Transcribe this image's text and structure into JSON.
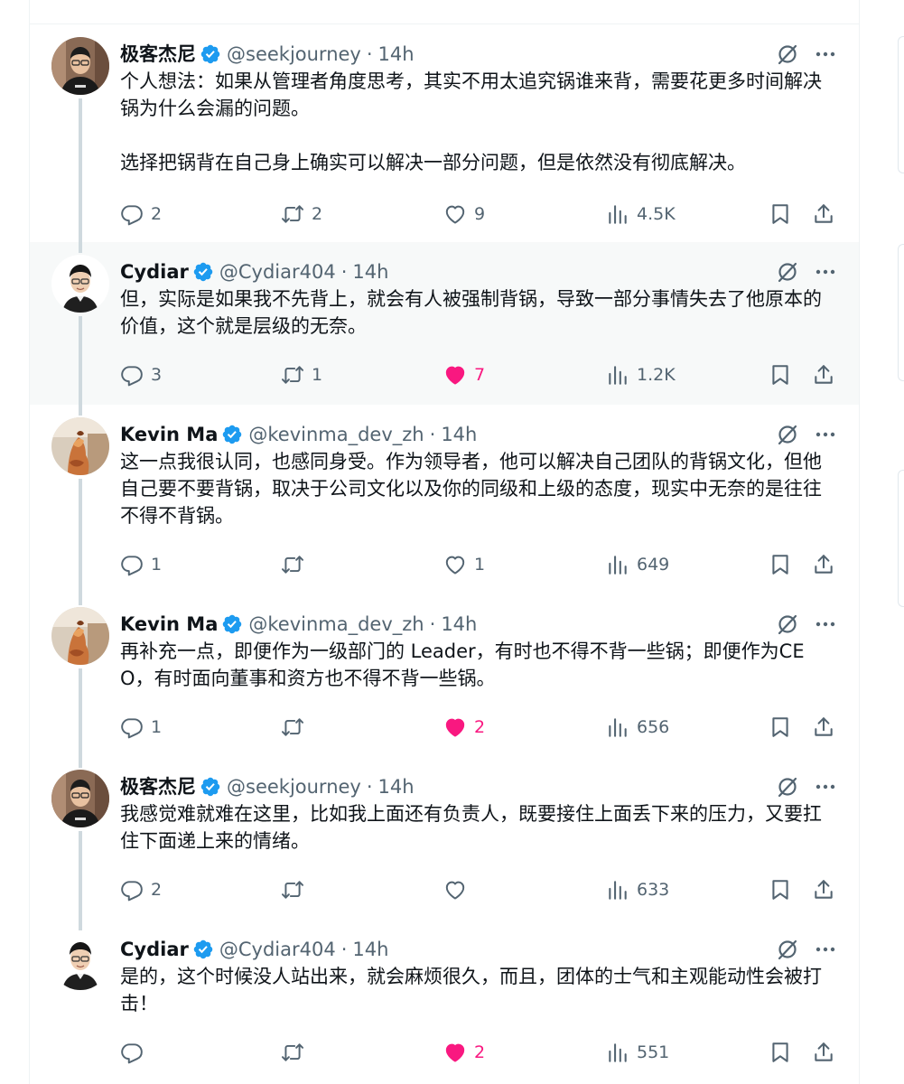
{
  "tweets": [
    {
      "name": "极客杰尼",
      "handle": "@seekjourney",
      "time": "14h",
      "text": "个人想法：如果从管理者角度思考，其实不用太追究锅谁来背，需要花更多时间解决锅为什么会漏的问题。\n\n选择把锅背在自己身上确实可以解决一部分问题，但是依然没有彻底解决。",
      "replies": "2",
      "retweets": "2",
      "likes": "9",
      "views": "4.5K",
      "liked": false,
      "avatar": "avatar-seek"
    },
    {
      "name": "Cydiar",
      "handle": "@Cydiar404",
      "time": "14h",
      "text": "但，实际是如果我不先背上，就会有人被强制背锅，导致一部分事情失去了他原本的价值，这个就是层级的无奈。",
      "replies": "3",
      "retweets": "1",
      "likes": "7",
      "views": "1.2K",
      "liked": true,
      "avatar": "avatar-cydiar"
    },
    {
      "name": "Kevin Ma",
      "handle": "@kevinma_dev_zh",
      "time": "14h",
      "text": "这一点我很认同，也感同身受。作为领导者，他可以解决自己团队的背锅文化，但他自己要不要背锅，取决于公司文化以及你的同级和上级的态度，现实中无奈的是往往不得不背锅。",
      "replies": "1",
      "retweets": "",
      "likes": "1",
      "views": "649",
      "liked": false,
      "avatar": "avatar-kevin"
    },
    {
      "name": "Kevin Ma",
      "handle": "@kevinma_dev_zh",
      "time": "14h",
      "text": "再补充一点，即便作为一级部门的 Leader，有时也不得不背一些锅；即便作为CEO，有时面向董事和资方也不得不背一些锅。",
      "replies": "1",
      "retweets": "",
      "likes": "2",
      "views": "656",
      "liked": true,
      "avatar": "avatar-kevin"
    },
    {
      "name": "极客杰尼",
      "handle": "@seekjourney",
      "time": "14h",
      "text": "我感觉难就难在这里，比如我上面还有负责人，既要接住上面丢下来的压力，又要扛住下面递上来的情绪。",
      "replies": "2",
      "retweets": "",
      "likes": "",
      "views": "633",
      "liked": false,
      "avatar": "avatar-seek"
    },
    {
      "name": "Cydiar",
      "handle": "@Cydiar404",
      "time": "14h",
      "text": "是的，这个时候没人站出来，就会麻烦很久，而且，团体的士气和主观能动性会被打击！",
      "replies": "",
      "retweets": "",
      "likes": "2",
      "views": "551",
      "liked": true,
      "avatar": "avatar-cydiar"
    }
  ],
  "colors": {
    "text": "#0f1419",
    "muted": "#536471",
    "verified": "#1d9bf0",
    "like": "#f91880",
    "thread": "#cfd9de",
    "highlight": "#f7f9f9"
  },
  "icons": [
    "verified-badge-icon",
    "grok-icon",
    "more-icon",
    "reply-icon",
    "retweet-icon",
    "like-icon",
    "views-icon",
    "bookmark-icon",
    "share-icon"
  ]
}
